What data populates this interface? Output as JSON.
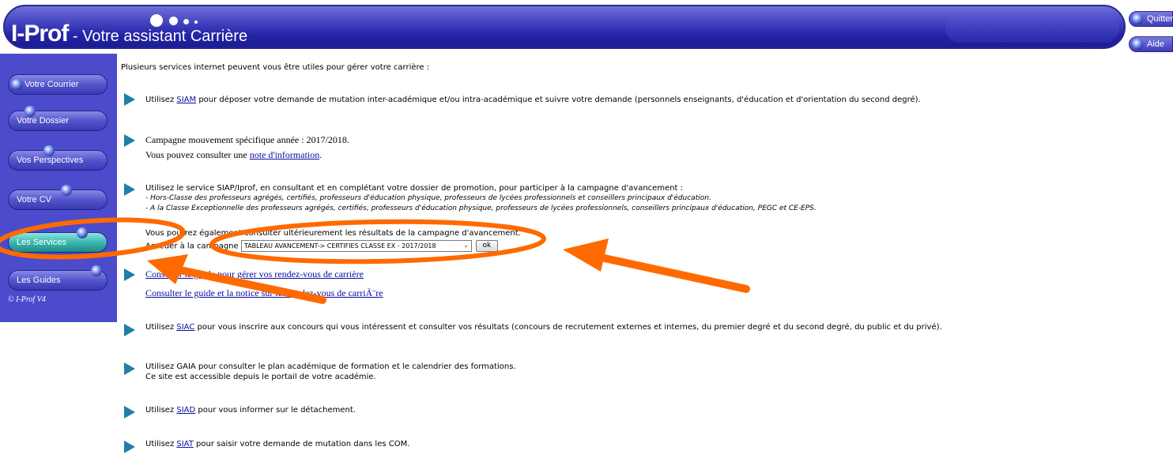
{
  "header": {
    "brand": "I-Prof",
    "tagline": " - Votre assistant Carrière",
    "quit_label": "Quitter",
    "help_label": "Aide"
  },
  "sidebar": {
    "items": [
      {
        "label": "Votre Courrier"
      },
      {
        "label": "Votre Dossier"
      },
      {
        "label": "Vos Perspectives"
      },
      {
        "label": "Votre CV"
      },
      {
        "label": "Les Services"
      },
      {
        "label": "Les Guides"
      }
    ],
    "copyright": "© I-Prof  V4"
  },
  "content": {
    "intro": "Plusieurs services internet peuvent vous être utiles pour gérer votre carrière :",
    "siam": {
      "prefix": "Utilisez ",
      "link": "SIAM",
      "suffix": " pour déposer votre demande de mutation inter-académique et/ou intra-académique et suivre votre demande (personnels enseignants, d'éducation et d'orientation du second degré)."
    },
    "campagne": {
      "line1": "Campagne mouvement spécifique année : 2017/2018.",
      "line2_prefix": "Vous pouvez consulter une ",
      "line2_link": "note d'information",
      "line2_suffix": "."
    },
    "siap": {
      "line1": "Utilisez le service SIAP/Iprof, en consultant et en complétant votre dossier de promotion, pour participer à la campagne d'avancement :",
      "line2": "- Hors-Classe des professeurs agrégés, certifiés, professeurs d'éducation physique, professeurs de lycées professionnels et conseillers principaux d'éducation.",
      "line3": "- A la Classe Exceptionnelle des professeurs agrégés, certifiés, professeurs d'éducation physique, professeurs de lycées professionnels, conseillers principaux d'éducation, PEGC et CE-EPS."
    },
    "results": {
      "line1": "Vous pourrez également consulter ultérieurement les résultats de la campagne d'avancement.",
      "access_label": "Accéder à la campagne",
      "select_value": "TABLEAU AVANCEMENT-> CERTIFIES CLASSE EX - 2017/2018",
      "ok_label": "ok"
    },
    "rdv": {
      "link1": "Consulter le guide pour gérer vos rendez-vous de carrière",
      "link2": "Consulter le guide et la notice sur les rendez-vous de carriÃ¨re"
    },
    "siac": {
      "prefix": "Utilisez ",
      "link": "SIAC",
      "suffix": " pour vous inscrire aux concours qui vous intéressent et consulter vos résultats (concours de recrutement externes et internes, du premier degré et du second degré, du public et du privé)."
    },
    "gaia": {
      "line1": "Utilisez GAIA pour consulter le plan académique de formation et le calendrier des formations.",
      "line2": "Ce site est accessible depuis le portail de votre académie."
    },
    "siad": {
      "prefix": "Utilisez ",
      "link": "SIAD",
      "suffix": " pour vous informer sur le détachement."
    },
    "siat": {
      "prefix": "Utilisez ",
      "link": "SIAT",
      "suffix": " pour saisir votre demande de mutation dans les COM."
    }
  },
  "colors": {
    "banner": "#2424a6",
    "sidebar": "#4b4bcc",
    "active_tab": "#3cb8b0",
    "arrow_bullet": "#1f7fa4",
    "annotation": "#ff6a00",
    "link": "#0a0aa0"
  }
}
